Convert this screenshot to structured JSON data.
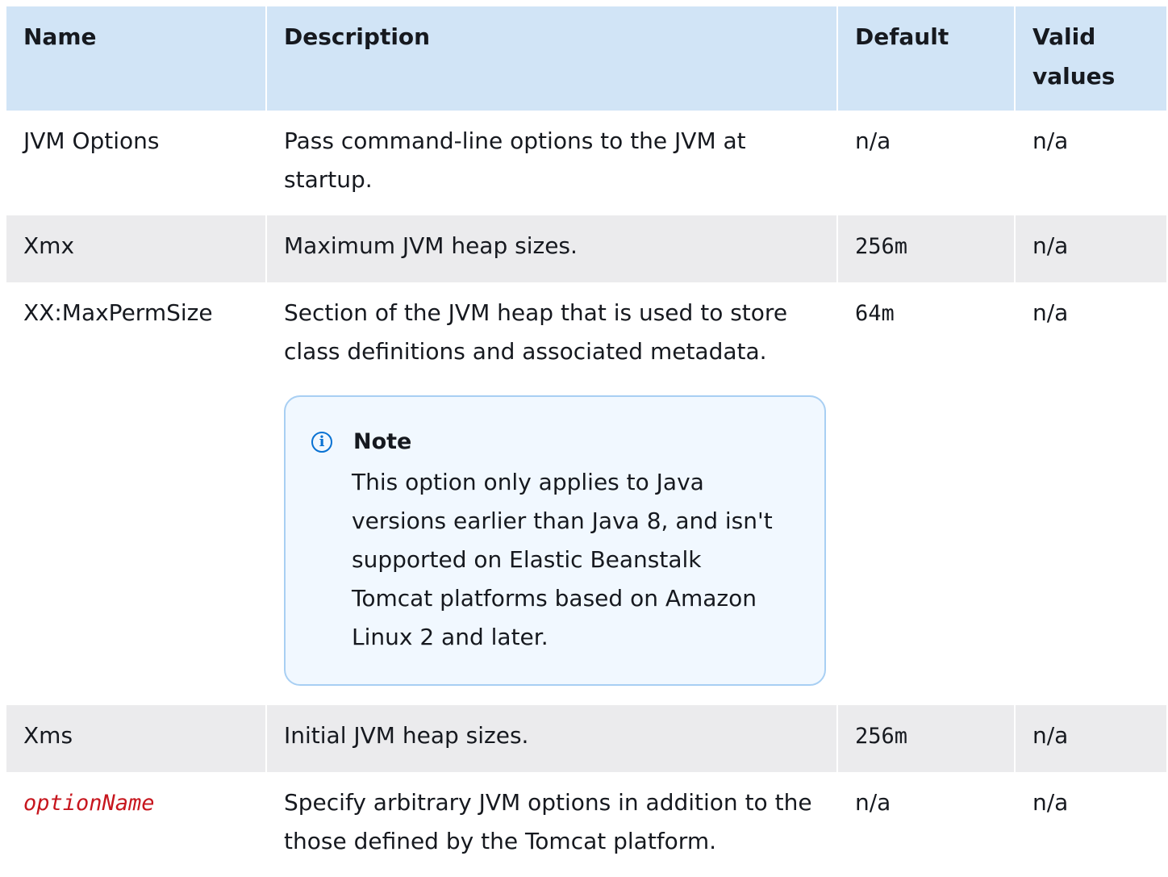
{
  "headers": {
    "name": "Name",
    "description": "Description",
    "default": "Default",
    "valid_values": "Valid values"
  },
  "rows": [
    {
      "name": "JVM Options",
      "description": "Pass command-line options to the JVM at startup.",
      "default": "n/a",
      "valid_values": "n/a"
    },
    {
      "name": "Xmx",
      "description": "Maximum JVM heap sizes.",
      "default": "256m",
      "valid_values": "n/a"
    },
    {
      "name": "XX:MaxPermSize",
      "description": "Section of the JVM heap that is used to store class definitions and associated metadata.",
      "default": "64m",
      "valid_values": "n/a",
      "note": {
        "title": "Note",
        "icon": "info-icon",
        "text": "This option only applies to Java versions earlier than Java 8, and isn't supported on Elastic Beanstalk Tomcat platforms based on Amazon Linux 2 and later."
      }
    },
    {
      "name": "Xms",
      "description": "Initial JVM heap sizes.",
      "default": "256m",
      "valid_values": "n/a"
    },
    {
      "name": "optionName",
      "description": "Specify arbitrary JVM options in addition to the those defined by the Tomcat platform.",
      "default": "n/a",
      "valid_values": "n/a"
    }
  ],
  "colors": {
    "header_bg": "#d1e4f6",
    "row_alt_bg": "#ebebed",
    "note_bg": "#f1f8ff",
    "note_border": "#a8cff3",
    "info_icon": "#0972d3",
    "placeholder_text": "#c7161e"
  }
}
